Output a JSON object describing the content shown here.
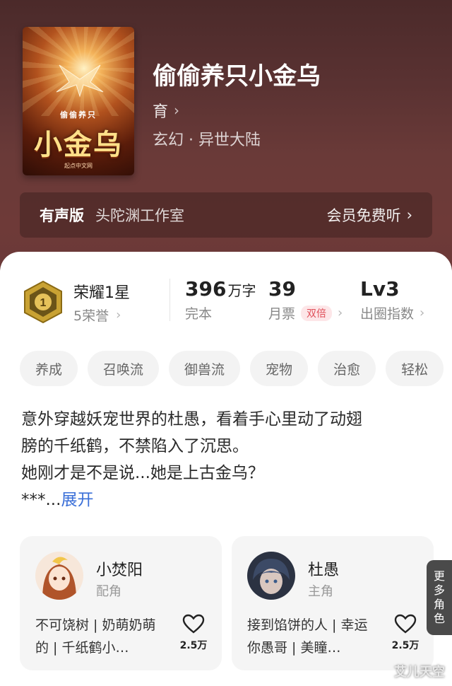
{
  "book": {
    "cover_small_title": "偷偷养只",
    "cover_big_title": "小金乌",
    "cover_publisher": "起点中文网",
    "title": "偷偷养只小金乌",
    "author": "育",
    "genre": "玄幻 · 异世大陆"
  },
  "audio": {
    "label": "有声版",
    "studio": "头陀渊工作室",
    "free_label": "会员免费听"
  },
  "honor": {
    "title": "荣耀1星",
    "sub": "5荣誉"
  },
  "stats": {
    "words_num": "396",
    "words_unit": "万字",
    "words_label": "完本",
    "tickets_num": "39",
    "tickets_label": "月票",
    "tickets_badge": "双倍",
    "index_num": "Lv3",
    "index_label": "出圈指数"
  },
  "tags": [
    "养成",
    "召唤流",
    "御兽流",
    "宠物",
    "治愈",
    "轻松"
  ],
  "description": {
    "line1": "意外穿越妖宠世界的杜愚，看着手心里动了动翅",
    "line2": "膀的千纸鹤，不禁陷入了沉思。",
    "line3": "她刚才是不是说...她是上古金乌？",
    "line4": "***...",
    "expand": "展开"
  },
  "characters": [
    {
      "name": "小焚阳",
      "role": "配角",
      "tagline": "不可饶树 | 奶萌奶萌的 | 千纸鹤小…",
      "likes": "2.5万"
    },
    {
      "name": "杜愚",
      "role": "主角",
      "tagline": "接到馅饼的人 | 幸运你愚哥 | 美瞳…",
      "likes": "2.5万"
    }
  ],
  "more_roles": "更多角色",
  "watermark": "艾儿天空",
  "colors": {
    "accent_blue": "#3a6fd8",
    "badge_red": "#e0505a",
    "hero_bg": "#5a3232"
  }
}
